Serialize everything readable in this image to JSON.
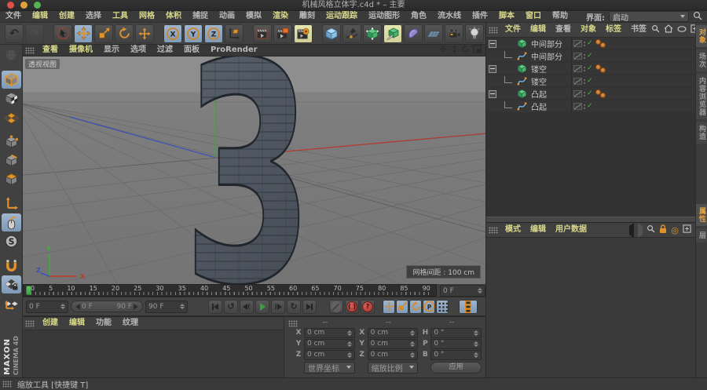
{
  "titlebar": {
    "title": "机械风格立体字.c4d * – 主要"
  },
  "menubar": {
    "items": [
      {
        "label": "文件",
        "hl": false
      },
      {
        "label": "编辑",
        "hl": true
      },
      {
        "label": "创建",
        "hl": true
      },
      {
        "label": "选择",
        "hl": false
      },
      {
        "label": "工具",
        "hl": true
      },
      {
        "label": "网格",
        "hl": true
      },
      {
        "label": "体积",
        "hl": true
      },
      {
        "label": "捕捉",
        "hl": false
      },
      {
        "label": "动画",
        "hl": false
      },
      {
        "label": "模拟",
        "hl": false
      },
      {
        "label": "渲染",
        "hl": true
      },
      {
        "label": "雕刻",
        "hl": false
      },
      {
        "label": "运动跟踪",
        "hl": true
      },
      {
        "label": "运动图形",
        "hl": false
      },
      {
        "label": "角色",
        "hl": false
      },
      {
        "label": "流水线",
        "hl": false
      },
      {
        "label": "插件",
        "hl": false
      },
      {
        "label": "脚本",
        "hl": true
      },
      {
        "label": "窗口",
        "hl": true
      },
      {
        "label": "帮助",
        "hl": false
      }
    ],
    "interface_label": "界面:",
    "interface_value": "启动"
  },
  "toolbar": {
    "x_label": "X",
    "y_label": "Y",
    "z_label": "Z"
  },
  "left_palette": {
    "snap_letter": "S",
    "logo_maxon": "MAXON",
    "logo_cinema": "CINEMA 4D"
  },
  "viewport": {
    "menu": [
      {
        "label": "查看",
        "hl": true
      },
      {
        "label": "摄像机",
        "hl": true
      },
      {
        "label": "显示",
        "hl": false
      },
      {
        "label": "选项",
        "hl": false
      },
      {
        "label": "过滤",
        "hl": false
      },
      {
        "label": "面板",
        "hl": false
      },
      {
        "label": "ProRender",
        "hl": false
      }
    ],
    "name_label": "透视视图",
    "grid_badge": "网格间距 : 100 cm",
    "model_glyph": "3",
    "axis_labels": {
      "x": "X",
      "y": "Y",
      "z": "Z"
    }
  },
  "timeline": {
    "ticks": [
      "0",
      "5",
      "10",
      "15",
      "20",
      "25",
      "30",
      "35",
      "40",
      "45",
      "50",
      "55",
      "60",
      "65",
      "70",
      "75",
      "80",
      "85",
      "90"
    ],
    "current_value": "0 F"
  },
  "transport": {
    "frame_field": "0 F",
    "range_start": "0 F",
    "range_end": "90 F",
    "end_field": "90 F",
    "p_label": "P"
  },
  "materials": {
    "menu": [
      {
        "label": "创建",
        "hl": true
      },
      {
        "label": "编辑",
        "hl": true
      },
      {
        "label": "功能",
        "hl": false
      },
      {
        "label": "纹理",
        "hl": false
      }
    ]
  },
  "coordinates": {
    "position": {
      "header": "--",
      "rows": [
        {
          "label": "X",
          "value": "0 cm"
        },
        {
          "label": "Y",
          "value": "0 cm"
        },
        {
          "label": "Z",
          "value": "0 cm"
        }
      ],
      "dropdown": "世界坐标"
    },
    "scale": {
      "header": "--",
      "rows": [
        {
          "label": "X",
          "value": "0 cm"
        },
        {
          "label": "Y",
          "value": "0 cm"
        },
        {
          "label": "Z",
          "value": "0 cm"
        }
      ],
      "dropdown": "缩放比例"
    },
    "rotation": {
      "header": "--",
      "rows": [
        {
          "label": "H",
          "value": "0 °"
        },
        {
          "label": "P",
          "value": "0 °"
        },
        {
          "label": "B",
          "value": "0 °"
        }
      ],
      "apply_label": "应用"
    }
  },
  "object_manager": {
    "menu": [
      {
        "label": "文件",
        "hl": true
      },
      {
        "label": "编辑",
        "hl": true
      },
      {
        "label": "查看",
        "hl": false
      },
      {
        "label": "对象",
        "hl": true
      },
      {
        "label": "标签",
        "hl": true
      },
      {
        "label": "书签",
        "hl": false
      }
    ],
    "rows": [
      {
        "name": "中间部分",
        "child": false
      },
      {
        "name": "中间部分",
        "child": true
      },
      {
        "name": "镂空",
        "child": false
      },
      {
        "name": "镂空",
        "child": true
      },
      {
        "name": "凸起",
        "child": false
      },
      {
        "name": "凸起",
        "child": true
      }
    ]
  },
  "attribute_manager": {
    "menu": [
      {
        "label": "模式",
        "hl": true
      },
      {
        "label": "编辑",
        "hl": true
      },
      {
        "label": "用户数据",
        "hl": true
      }
    ]
  },
  "right_tabs": {
    "top": [
      {
        "label": "对象",
        "active": true
      },
      {
        "label": "场次",
        "active": false
      },
      {
        "label": "内容浏览器",
        "active": false
      },
      {
        "label": "构造",
        "active": false
      }
    ],
    "bottom": [
      {
        "label": "属性",
        "active": true
      },
      {
        "label": "层",
        "active": false
      }
    ]
  },
  "statusbar": {
    "text": "缩放工具 [快捷键 T]"
  }
}
